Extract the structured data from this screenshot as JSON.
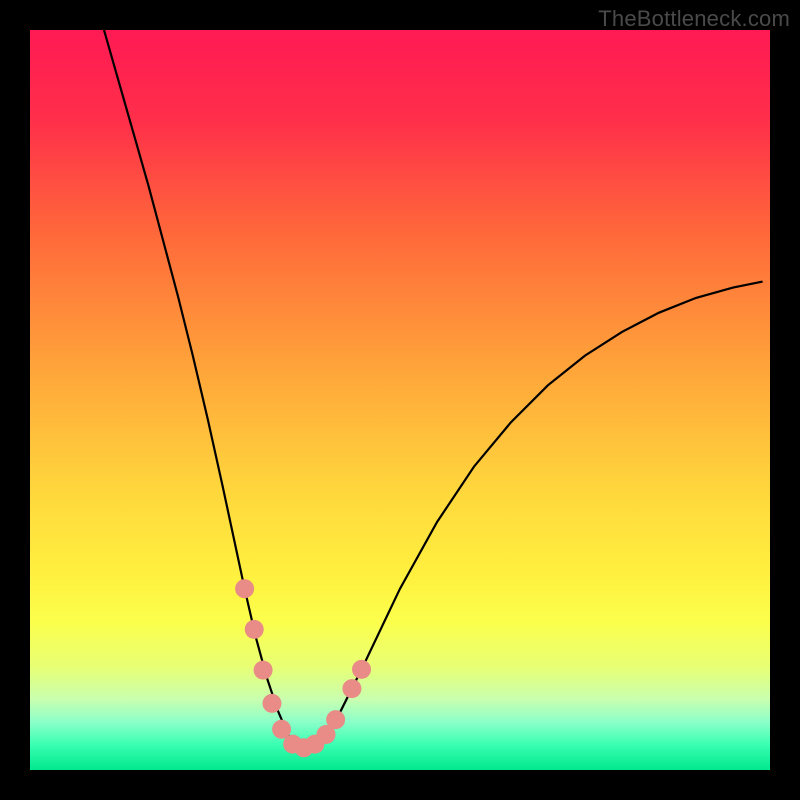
{
  "watermark": "TheBottleneck.com",
  "chart_data": {
    "type": "line",
    "title": "",
    "xlabel": "",
    "ylabel": "",
    "xlim": [
      0,
      100
    ],
    "ylim": [
      0,
      100
    ],
    "grid": false,
    "legend": false,
    "background_gradient": {
      "stops": [
        {
          "offset": 0.0,
          "color": "#ff1a54"
        },
        {
          "offset": 0.12,
          "color": "#ff2e4a"
        },
        {
          "offset": 0.28,
          "color": "#ff6a3a"
        },
        {
          "offset": 0.45,
          "color": "#ffa23a"
        },
        {
          "offset": 0.62,
          "color": "#ffd63c"
        },
        {
          "offset": 0.74,
          "color": "#fff13f"
        },
        {
          "offset": 0.8,
          "color": "#fbff4c"
        },
        {
          "offset": 0.86,
          "color": "#e8ff74"
        },
        {
          "offset": 0.905,
          "color": "#c8ffb0"
        },
        {
          "offset": 0.935,
          "color": "#8cffc9"
        },
        {
          "offset": 0.965,
          "color": "#3bffb3"
        },
        {
          "offset": 1.0,
          "color": "#00e88e"
        }
      ]
    },
    "series": [
      {
        "name": "curve",
        "color": "#000000",
        "stroke_width": 2.2,
        "x": [
          10.0,
          12.0,
          14.0,
          16.0,
          18.0,
          20.0,
          22.0,
          24.0,
          26.0,
          27.5,
          29.0,
          30.5,
          32.0,
          33.5,
          35.0,
          36.5,
          38.0,
          40.0,
          42.0,
          45.0,
          50.0,
          55.0,
          60.0,
          65.0,
          70.0,
          75.0,
          80.0,
          85.0,
          90.0,
          95.0,
          99.0
        ],
        "y": [
          100.0,
          93.0,
          86.0,
          79.0,
          71.5,
          64.0,
          56.0,
          47.5,
          38.5,
          31.5,
          24.5,
          18.0,
          12.5,
          8.0,
          4.5,
          3.0,
          3.0,
          4.8,
          8.0,
          14.0,
          24.5,
          33.5,
          41.0,
          47.0,
          52.0,
          56.0,
          59.2,
          61.8,
          63.8,
          65.2,
          66.0
        ]
      }
    ],
    "markers": {
      "name": "salmon-markers",
      "color": "#e98b86",
      "radius": 9.5,
      "points": [
        {
          "x": 29.0,
          "y": 24.5
        },
        {
          "x": 30.3,
          "y": 19.0
        },
        {
          "x": 31.5,
          "y": 13.5
        },
        {
          "x": 32.7,
          "y": 9.0
        },
        {
          "x": 34.0,
          "y": 5.5
        },
        {
          "x": 35.5,
          "y": 3.5
        },
        {
          "x": 37.0,
          "y": 3.0
        },
        {
          "x": 38.5,
          "y": 3.5
        },
        {
          "x": 40.0,
          "y": 4.8
        },
        {
          "x": 41.3,
          "y": 6.8
        },
        {
          "x": 43.5,
          "y": 11.0
        },
        {
          "x": 44.8,
          "y": 13.6
        }
      ]
    }
  }
}
